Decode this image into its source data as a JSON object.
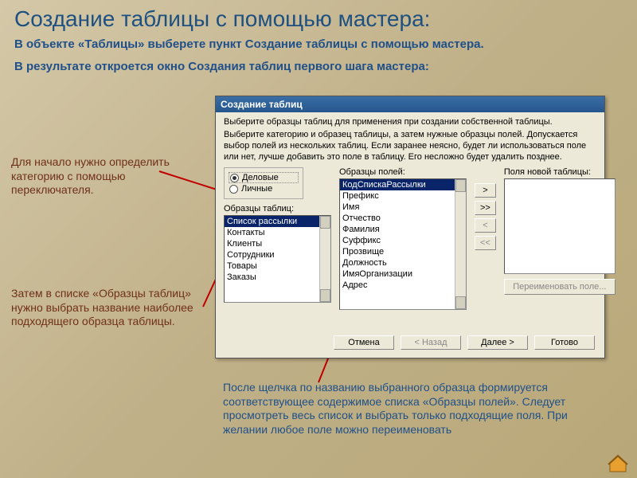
{
  "title": "Создание таблицы с помощью мастера:",
  "para1": "В объекте «Таблицы» выберете пункт Создание таблицы с помощью мастера.",
  "para2": "В результате откроется окно Создания таблиц первого шага мастера:",
  "annot1": "Для начало нужно определить категорию с помощью переключателя.",
  "annot2": "Затем в списке  «Образцы таблиц» нужно выбрать название наиболее подходящего образца таблицы.",
  "annot3": "После щелчка по названию выбранного образца формируется соответствующее содержимое списка «Образцы полей». Следует просмотреть весь список и выбрать только подходящие поля. При желании любое поле можно переименовать",
  "dialog": {
    "title": "Создание таблиц",
    "intro1": "Выберите образцы таблиц для применения при создании собственной таблицы.",
    "intro2": "Выберите категорию и образец таблицы, а затем нужные образцы полей. Допускается выбор полей из нескольких таблиц. Если заранее неясно, будет ли использоваться поле или нет, лучше добавить это поле в таблицу. Его несложно будет удалить позднее.",
    "radio1": "Деловые",
    "radio2": "Личные",
    "samplesLabel": "Образцы таблиц:",
    "fieldsLabel": "Образцы полей:",
    "newFieldsLabel": "Поля новой таблицы:",
    "samples": [
      "Список рассылки",
      "Контакты",
      "Клиенты",
      "Сотрудники",
      "Товары",
      "Заказы"
    ],
    "fields": [
      "КодСпискаРассылки",
      "Префикс",
      "Имя",
      "Отчество",
      "Фамилия",
      "Суффикс",
      "Прозвище",
      "Должность",
      "ИмяОрганизации",
      "Адрес"
    ],
    "move": {
      "add": ">",
      "addAll": ">>",
      "remove": "<",
      "removeAll": "<<"
    },
    "rename": "Переименовать поле...",
    "cancel": "Отмена",
    "back": "< Назад",
    "next": "Далее >",
    "finish": "Готово"
  }
}
